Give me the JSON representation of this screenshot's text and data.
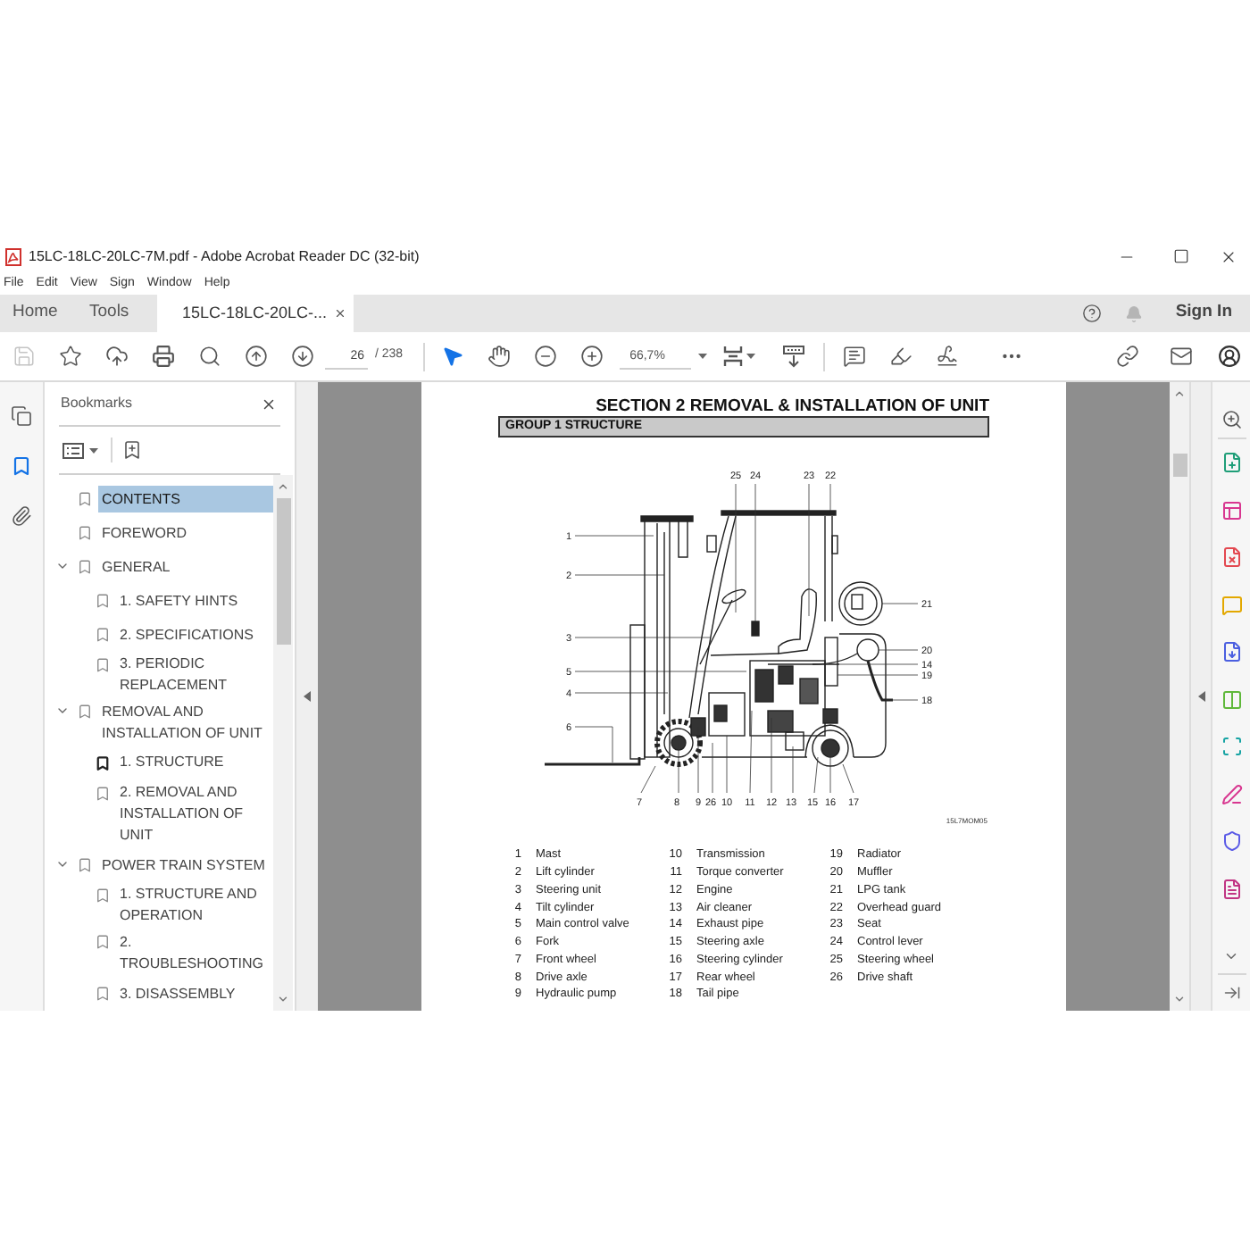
{
  "window": {
    "title": "15LC-18LC-20LC-7M.pdf - Adobe Acrobat Reader DC (32-bit)"
  },
  "menu": [
    "File",
    "Edit",
    "View",
    "Sign",
    "Window",
    "Help"
  ],
  "tabs": [
    {
      "label": "Home",
      "kind": "nav",
      "selected": false
    },
    {
      "label": "Tools",
      "kind": "nav",
      "selected": false
    },
    {
      "label": "15LC-18LC-20LC-...",
      "kind": "document",
      "selected": true
    }
  ],
  "account": {
    "sign_in": "Sign In"
  },
  "toolbar": {
    "save": {
      "disabled": true
    },
    "page_number": "26",
    "page_count": "/ 238",
    "pointer_tools": [
      {
        "kind": "select",
        "selected": true
      },
      {
        "kind": "hand",
        "selected": false
      }
    ],
    "zoom": "66,7%"
  },
  "left_rail": [
    {
      "kind": "pages",
      "selected": false
    },
    {
      "kind": "bookmarks",
      "selected": true
    },
    {
      "kind": "attachments",
      "selected": false
    }
  ],
  "bookmarks": {
    "title": "Bookmarks",
    "items": [
      {
        "label": "CONTENTS",
        "selected": true,
        "current": false
      },
      {
        "label": "FOREWORD",
        "selected": false,
        "current": false
      },
      {
        "label": "GENERAL",
        "selected": false,
        "current": false,
        "expanded": true,
        "children": [
          {
            "label": "1. SAFETY HINTS",
            "selected": false,
            "current": false
          },
          {
            "label": "2. SPECIFICATIONS",
            "selected": false,
            "current": false
          },
          {
            "label": "3. PERIODIC REPLACEMENT",
            "selected": false,
            "current": false
          }
        ]
      },
      {
        "label": "REMOVAL AND INSTALLATION OF UNIT",
        "selected": false,
        "current": false,
        "expanded": true,
        "children": [
          {
            "label": "1. STRUCTURE",
            "selected": false,
            "current": true
          },
          {
            "label": "2. REMOVAL AND INSTALLATION OF UNIT",
            "selected": false,
            "current": false
          }
        ]
      },
      {
        "label": "POWER TRAIN SYSTEM",
        "selected": false,
        "current": false,
        "expanded": true,
        "children": [
          {
            "label": "1. STRUCTURE AND OPERATION",
            "selected": false,
            "current": false
          },
          {
            "label": "2. TROUBLESHOOTING",
            "selected": false,
            "current": false
          },
          {
            "label": "3. DISASSEMBLY",
            "selected": false,
            "current": false
          }
        ]
      }
    ]
  },
  "page": {
    "section_title": "SECTION 2 REMOVAL & INSTALLATION OF UNIT",
    "group_title": "GROUP 1 STRUCTURE",
    "diagram": {
      "callouts": [
        "25",
        "24",
        "23",
        "22",
        "1",
        "2",
        "3",
        "5",
        "4",
        "6",
        "21",
        "20",
        "14",
        "19",
        "18",
        "7",
        "8",
        "9",
        "26",
        "10",
        "11",
        "12",
        "13",
        "15",
        "16",
        "17"
      ],
      "caption": "15L7MOM05"
    },
    "legend": [
      {
        "number": "1",
        "name": "Mast"
      },
      {
        "number": "2",
        "name": "Lift cylinder"
      },
      {
        "number": "3",
        "name": "Steering unit"
      },
      {
        "number": "4",
        "name": "Tilt cylinder"
      },
      {
        "number": "5",
        "name": "Main control valve"
      },
      {
        "number": "6",
        "name": "Fork"
      },
      {
        "number": "7",
        "name": "Front wheel"
      },
      {
        "number": "8",
        "name": "Drive axle"
      },
      {
        "number": "9",
        "name": "Hydraulic pump"
      },
      {
        "number": "10",
        "name": "Transmission"
      },
      {
        "number": "11",
        "name": "Torque converter"
      },
      {
        "number": "12",
        "name": "Engine"
      },
      {
        "number": "13",
        "name": "Air cleaner"
      },
      {
        "number": "14",
        "name": "Exhaust pipe"
      },
      {
        "number": "15",
        "name": "Steering axle"
      },
      {
        "number": "16",
        "name": "Steering cylinder"
      },
      {
        "number": "17",
        "name": "Rear wheel"
      },
      {
        "number": "18",
        "name": "Tail pipe"
      },
      {
        "number": "19",
        "name": "Radiator"
      },
      {
        "number": "20",
        "name": "Muffler"
      },
      {
        "number": "21",
        "name": "LPG tank"
      },
      {
        "number": "22",
        "name": "Overhead guard"
      },
      {
        "number": "23",
        "name": "Seat"
      },
      {
        "number": "24",
        "name": "Control lever"
      },
      {
        "number": "25",
        "name": "Steering wheel"
      },
      {
        "number": "26",
        "name": "Drive shaft"
      }
    ]
  }
}
